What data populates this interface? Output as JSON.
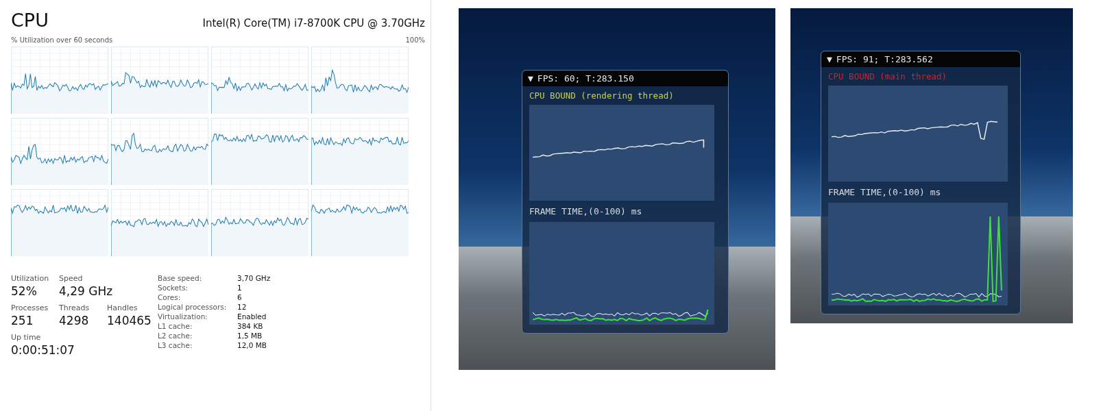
{
  "cpu_panel": {
    "title": "CPU",
    "processor": "Intel(R) Core(TM) i7-8700K CPU @ 3.70GHz",
    "graph_caption": "% Utilization over 60 seconds",
    "graph_max": "100%",
    "stat_rows": [
      [
        {
          "label": "Utilization",
          "value": "52%"
        },
        {
          "label": "Speed",
          "value": "4,29 GHz"
        }
      ],
      [
        {
          "label": "Processes",
          "value": "251"
        },
        {
          "label": "Threads",
          "value": "4298"
        },
        {
          "label": "Handles",
          "value": "140465"
        }
      ],
      [
        {
          "label": "Up time",
          "value": "0:00:51:07"
        }
      ]
    ],
    "details": [
      {
        "label": "Base speed:",
        "value": "3,70 GHz"
      },
      {
        "label": "Sockets:",
        "value": "1"
      },
      {
        "label": "Cores:",
        "value": "6"
      },
      {
        "label": "Logical processors:",
        "value": "12"
      },
      {
        "label": "Virtualization:",
        "value": "Enabled"
      },
      {
        "label": "L1 cache:",
        "value": "384 KB"
      },
      {
        "label": "L2 cache:",
        "value": "1,5 MB"
      },
      {
        "label": "L3 cache:",
        "value": "12,0 MB"
      }
    ]
  },
  "overlays": [
    {
      "toggle": "▼",
      "header": "FPS: 60; T:283.150",
      "status": "CPU BOUND (rendering thread)",
      "color": "#c8d23c",
      "frame_time_label": "FRAME TIME,(0-100) ms"
    },
    {
      "toggle": "▼",
      "header": "FPS: 91; T:283.562",
      "status": "CPU BOUND (main thread)",
      "color": "#d0202a",
      "frame_time_label": "FRAME TIME,(0-100) ms"
    }
  ]
}
